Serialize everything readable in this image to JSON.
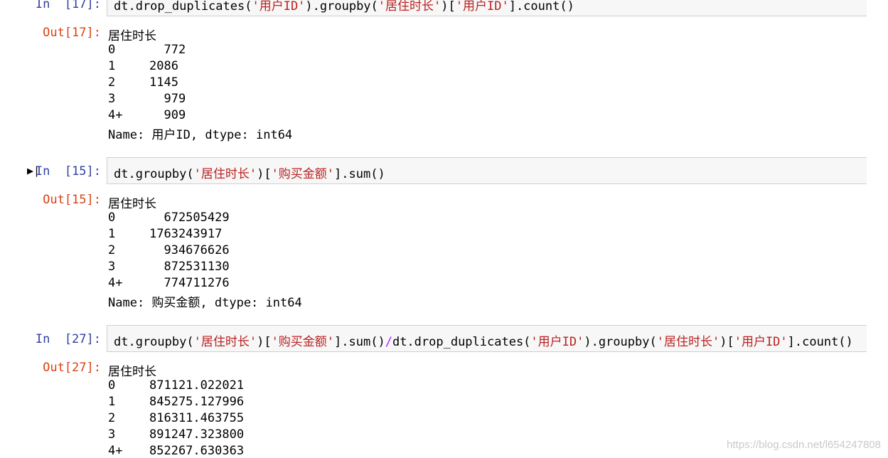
{
  "cells": [
    {
      "in_prompt": "In  [17]:",
      "code": {
        "p1": "dt.drop_duplicates(",
        "s1": "'用户ID'",
        "p2": ").groupby(",
        "s2": "'居住时长'",
        "p3": ")[",
        "s3": "'用户ID'",
        "p4": "].count()"
      },
      "out_prompt": "Out[17]:",
      "header": "居住时长",
      "rows": [
        {
          "idx": "0",
          "val": "  772"
        },
        {
          "idx": "1",
          "val": "2086"
        },
        {
          "idx": "2",
          "val": "1145"
        },
        {
          "idx": "3",
          "val": "  979"
        },
        {
          "idx": "4+",
          "val": "  909"
        }
      ],
      "footer": "Name: 用户ID, dtype: int64"
    },
    {
      "in_prompt": "In  [15]:",
      "code": {
        "p1": "dt.groupby(",
        "s1": "'居住时长'",
        "p2": ")[",
        "s2": "'购买金额'",
        "p3": "].sum()"
      },
      "out_prompt": "Out[15]:",
      "header": "居住时长",
      "rows": [
        {
          "idx": "0",
          "val": "  672505429"
        },
        {
          "idx": "1",
          "val": "1763243917"
        },
        {
          "idx": "2",
          "val": "  934676626"
        },
        {
          "idx": "3",
          "val": "  872531130"
        },
        {
          "idx": "4+",
          "val": "  774711276"
        }
      ],
      "footer": "Name: 购买金额, dtype: int64"
    },
    {
      "in_prompt": "In  [27]:",
      "code": {
        "p1": "dt.groupby(",
        "s1": "'居住时长'",
        "p2": ")[",
        "s2": "'购买金额'",
        "p3": "].sum()",
        "op": "/",
        "p4": "dt.drop_duplicates(",
        "s3": "'用户ID'",
        "p5": ").groupby(",
        "s4": "'居住时长'",
        "p6": ")[",
        "s5": "'用户ID'",
        "p7": "].count()"
      },
      "out_prompt": "Out[27]:",
      "header": "居住时长",
      "rows": [
        {
          "idx": "0",
          "val": "871121.022021"
        },
        {
          "idx": "1",
          "val": "845275.127996"
        },
        {
          "idx": "2",
          "val": "816311.463755"
        },
        {
          "idx": "3",
          "val": "891247.323800"
        },
        {
          "idx": "4+",
          "val": "852267.630363"
        }
      ]
    }
  ],
  "run_icon": "run-cell-icon",
  "watermark": "https://blog.csdn.net/l654247808"
}
